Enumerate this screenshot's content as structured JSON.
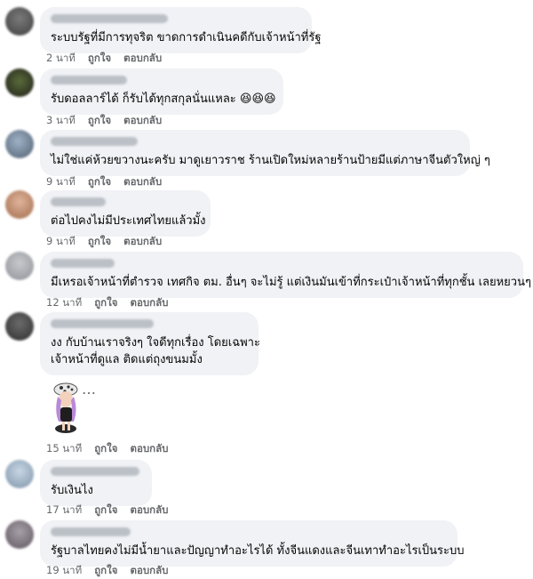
{
  "comments": [
    {
      "text": "ระบบรัฐที่มีการทุจริต ขาดการดำเนินคดีกับเจ้าหน้าที่รัฐ",
      "time": "2 นาที",
      "like": "ถูกใจ",
      "reply": "ตอบกลับ"
    },
    {
      "text": "รับดอลลาร์ได้ ก็รับได้ทุกสกุลนั่นแหละ 😆😆😆",
      "time": "3 นาที",
      "like": "ถูกใจ",
      "reply": "ตอบกลับ"
    },
    {
      "text": "ไม่ใช่แค่ห้วยขวางนะครับ มาดูเยาวราช ร้านเปิดใหม่หลายร้านป้ายมีแต่ภาษาจีนตัวใหญ่ ๆ",
      "time": "9 นาที",
      "like": "ถูกใจ",
      "reply": "ตอบกลับ"
    },
    {
      "text": "ต่อไปคงไม่มีประเทศไทยแล้วมั้ง",
      "time": "9 นาที",
      "like": "ถูกใจ",
      "reply": "ตอบกลับ"
    },
    {
      "text": "มีเหรอเจ้าหน้าที่ตำรวจ เทศกิจ ตม. อื่นๆ จะไม่รู้ แต่เงินมันเข้าที่กระเป๋าเจ้าหน้าที่ทุกชั้น เลยหยวนๆ",
      "time": "12 นาที",
      "like": "ถูกใจ",
      "reply": "ตอบกลับ"
    },
    {
      "text_line1": "งง กับบ้านเราจริงๆ ใจดีทุกเรื่อง โดยเฉพาะ",
      "text_line2": "เจ้าหน้าที่ดูแล ติดแต่ถุงขนมมั้ง",
      "time": "15 นาที",
      "like": "ถูกใจ",
      "reply": "ตอบกลับ"
    },
    {
      "text": "รับเงินไง",
      "time": "17 นาที",
      "like": "ถูกใจ",
      "reply": "ตอบกลับ"
    },
    {
      "text": "รัฐบาลไทยคงไม่มีน้ำยาและปัญญาทำอะไรได้ ทั้งจีนแดงและจีนเทาทำอะไรเป็นระบบ",
      "time": "19 นาที",
      "like": "ถูกใจ",
      "reply": "ตอบกลับ"
    }
  ],
  "sticker": {
    "more_icon": "…"
  },
  "colors": {
    "bubble": "#f0f2f5",
    "meta": "#65676b"
  }
}
